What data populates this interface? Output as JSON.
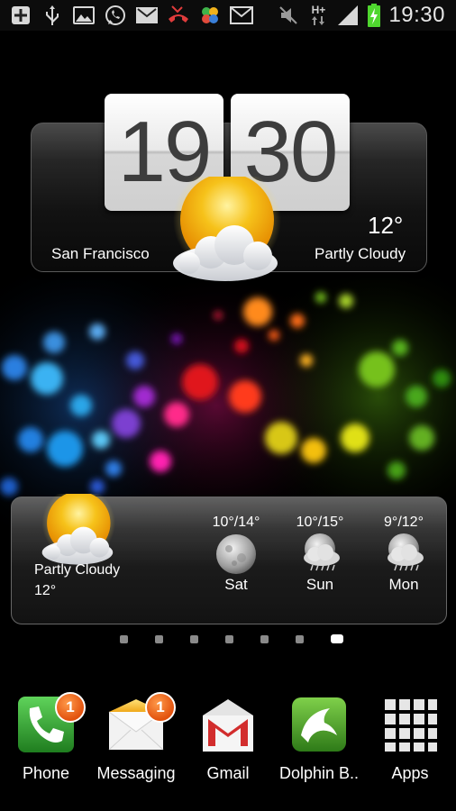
{
  "status_bar": {
    "time": "19:30",
    "network_type": "H+",
    "left_icons": [
      "add-icon",
      "usb-icon",
      "gallery-icon",
      "whatsapp-icon",
      "email-icon",
      "missed-call-icon",
      "clover-icon",
      "message-icon"
    ],
    "right_icons": [
      "mute-icon",
      "network-arrows-icon",
      "signal-icon",
      "battery-charging-icon"
    ]
  },
  "clock_widget": {
    "hours": "19",
    "minutes": "30",
    "city": "San Francisco",
    "temperature": "12°",
    "condition": "Partly Cloudy"
  },
  "forecast_widget": {
    "current_condition": "Partly Cloudy",
    "current_temp": "12°",
    "days": [
      {
        "day": "Sat",
        "range": "10°/14°",
        "icon": "moon-icon"
      },
      {
        "day": "Sun",
        "range": "10°/15°",
        "icon": "moon-rain-icon"
      },
      {
        "day": "Mon",
        "range": "9°/12°",
        "icon": "moon-rain-icon"
      }
    ]
  },
  "pager": {
    "pages": 7,
    "active_page": 7
  },
  "dock": [
    {
      "label": "Phone",
      "badge": "1"
    },
    {
      "label": "Messaging",
      "badge": "1"
    },
    {
      "label": "Gmail",
      "badge": ""
    },
    {
      "label": "Dolphin B..",
      "badge": ""
    },
    {
      "label": "Apps",
      "badge": ""
    }
  ],
  "colors": {
    "phone_green": "#2f9a2f",
    "gmail_red": "#d22d2d",
    "dolphin_green": "#3d8d22",
    "badge_orange": "#e2520e",
    "sun_yellow": "#f6b80b"
  }
}
